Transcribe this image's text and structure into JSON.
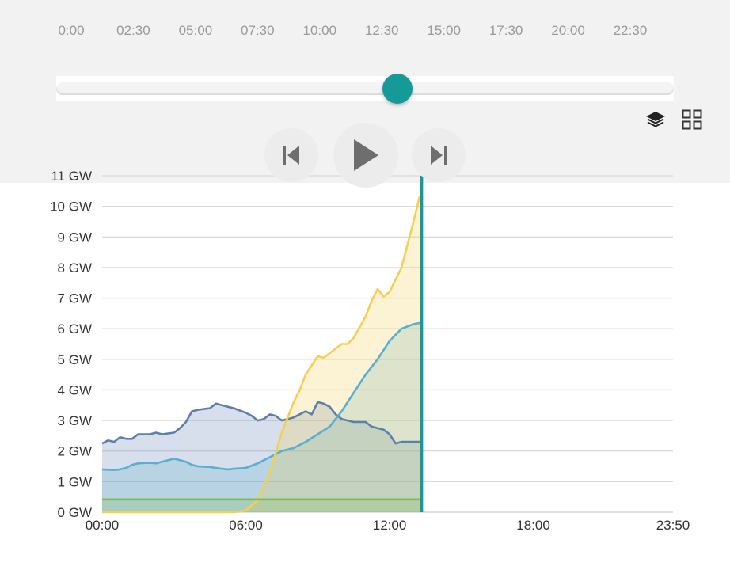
{
  "timeline": {
    "labels": [
      "0:00",
      "02:30",
      "05:00",
      "07:30",
      "10:00",
      "12:30",
      "15:00",
      "17:30",
      "20:00",
      "22:30"
    ],
    "position": 0.553
  },
  "controls": {
    "layers_icon": "layers-icon",
    "grid_icon": "grid-icon",
    "prev_icon": "skip-back-icon",
    "play_icon": "play-icon",
    "next_icon": "skip-forward-icon"
  },
  "colors": {
    "accent": "#149a98",
    "solar": "#f3cf55",
    "wind": "#5aaecf",
    "other": "#5b80ae",
    "base": "#7cbd4f"
  },
  "chart_data": {
    "type": "area",
    "y_tick_labels": [
      "0 GW",
      "1 GW",
      "2 GW",
      "3 GW",
      "4 GW",
      "5 GW",
      "6 GW",
      "7 GW",
      "8 GW",
      "9 GW",
      "10 GW",
      "11 GW"
    ],
    "x_tick_labels": [
      "00:00",
      "06:00",
      "12:00",
      "18:00",
      "23:50"
    ],
    "ylim": [
      0,
      11
    ],
    "xlim": [
      "00:00",
      "23:50"
    ],
    "current_time": "13:20",
    "grid": true,
    "series": [
      {
        "color": "#5b80ae",
        "points": [
          [
            "00:00",
            2.25
          ],
          [
            "00:15",
            2.35
          ],
          [
            "00:30",
            2.3
          ],
          [
            "00:45",
            2.45
          ],
          [
            "01:00",
            2.4
          ],
          [
            "01:15",
            2.4
          ],
          [
            "01:30",
            2.55
          ],
          [
            "02:00",
            2.55
          ],
          [
            "02:15",
            2.6
          ],
          [
            "02:30",
            2.55
          ],
          [
            "03:00",
            2.6
          ],
          [
            "03:15",
            2.75
          ],
          [
            "03:30",
            2.95
          ],
          [
            "03:45",
            3.3
          ],
          [
            "04:00",
            3.35
          ],
          [
            "04:30",
            3.4
          ],
          [
            "04:45",
            3.55
          ],
          [
            "05:00",
            3.5
          ],
          [
            "05:15",
            3.45
          ],
          [
            "05:30",
            3.4
          ],
          [
            "06:00",
            3.25
          ],
          [
            "06:15",
            3.15
          ],
          [
            "06:30",
            3.0
          ],
          [
            "06:45",
            3.05
          ],
          [
            "07:00",
            3.2
          ],
          [
            "07:15",
            3.15
          ],
          [
            "07:30",
            3.0
          ],
          [
            "07:45",
            3.05
          ],
          [
            "08:00",
            3.1
          ],
          [
            "08:30",
            3.3
          ],
          [
            "08:45",
            3.2
          ],
          [
            "09:00",
            3.6
          ],
          [
            "09:15",
            3.55
          ],
          [
            "09:30",
            3.45
          ],
          [
            "09:45",
            3.2
          ],
          [
            "10:00",
            3.05
          ],
          [
            "10:15",
            3.0
          ],
          [
            "10:30",
            2.95
          ],
          [
            "11:00",
            2.95
          ],
          [
            "11:15",
            2.8
          ],
          [
            "11:30",
            2.75
          ],
          [
            "11:45",
            2.7
          ],
          [
            "12:00",
            2.55
          ],
          [
            "12:15",
            2.25
          ],
          [
            "12:30",
            2.3
          ],
          [
            "13:00",
            2.3
          ],
          [
            "13:20",
            2.3
          ]
        ]
      },
      {
        "color": "#5aaecf",
        "points": [
          [
            "00:00",
            1.4
          ],
          [
            "00:30",
            1.38
          ],
          [
            "00:45",
            1.4
          ],
          [
            "01:00",
            1.45
          ],
          [
            "01:15",
            1.55
          ],
          [
            "01:30",
            1.6
          ],
          [
            "02:00",
            1.62
          ],
          [
            "02:15",
            1.6
          ],
          [
            "02:30",
            1.65
          ],
          [
            "03:00",
            1.75
          ],
          [
            "03:15",
            1.7
          ],
          [
            "03:30",
            1.65
          ],
          [
            "03:45",
            1.55
          ],
          [
            "04:00",
            1.5
          ],
          [
            "04:30",
            1.48
          ],
          [
            "04:45",
            1.45
          ],
          [
            "05:00",
            1.42
          ],
          [
            "05:15",
            1.4
          ],
          [
            "05:30",
            1.42
          ],
          [
            "06:00",
            1.45
          ],
          [
            "06:30",
            1.6
          ],
          [
            "07:00",
            1.8
          ],
          [
            "07:30",
            2.0
          ],
          [
            "08:00",
            2.1
          ],
          [
            "08:30",
            2.3
          ],
          [
            "09:00",
            2.55
          ],
          [
            "09:30",
            2.8
          ],
          [
            "10:00",
            3.3
          ],
          [
            "10:30",
            3.9
          ],
          [
            "11:00",
            4.5
          ],
          [
            "11:30",
            5.0
          ],
          [
            "12:00",
            5.6
          ],
          [
            "12:30",
            6.0
          ],
          [
            "13:00",
            6.15
          ],
          [
            "13:20",
            6.2
          ]
        ]
      },
      {
        "color": "#f3cf55",
        "points": [
          [
            "00:00",
            0.0
          ],
          [
            "05:30",
            0.0
          ],
          [
            "06:00",
            0.05
          ],
          [
            "06:30",
            0.4
          ],
          [
            "07:00",
            1.3
          ],
          [
            "07:30",
            2.6
          ],
          [
            "08:00",
            3.6
          ],
          [
            "08:15",
            4.0
          ],
          [
            "08:30",
            4.5
          ],
          [
            "09:00",
            5.1
          ],
          [
            "09:15",
            5.05
          ],
          [
            "09:30",
            5.2
          ],
          [
            "10:00",
            5.5
          ],
          [
            "10:15",
            5.5
          ],
          [
            "10:30",
            5.7
          ],
          [
            "11:00",
            6.4
          ],
          [
            "11:15",
            6.9
          ],
          [
            "11:30",
            7.3
          ],
          [
            "11:45",
            7.05
          ],
          [
            "12:00",
            7.2
          ],
          [
            "12:30",
            8.0
          ],
          [
            "13:00",
            9.5
          ],
          [
            "13:15",
            10.3
          ],
          [
            "13:20",
            10.3
          ]
        ]
      },
      {
        "color": "#7cbd4f",
        "points": [
          [
            "00:00",
            0.42
          ],
          [
            "13:20",
            0.42
          ]
        ]
      }
    ]
  }
}
